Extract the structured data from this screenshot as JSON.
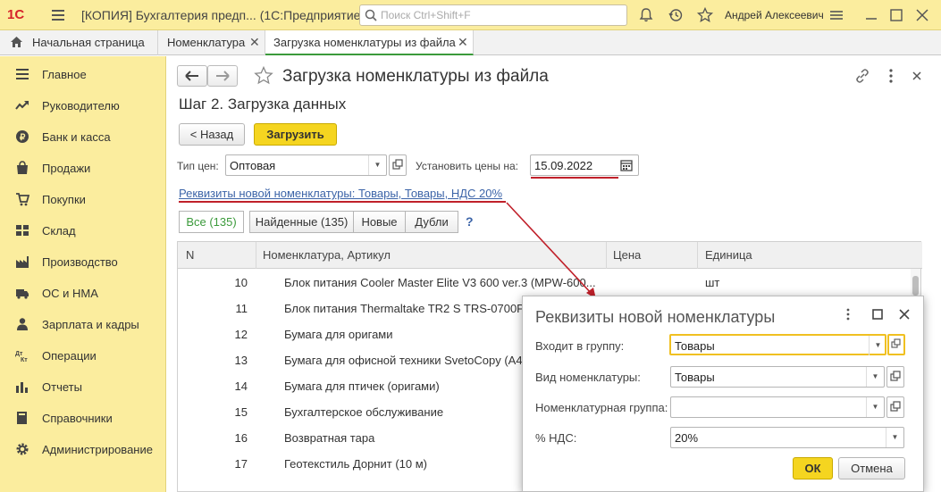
{
  "topbar": {
    "logo": "1С",
    "title": "[КОПИЯ] Бухгалтерия предп... (1С:Предприятие)",
    "search_placeholder": "Поиск Ctrl+Shift+F",
    "user": "Андрей Алексеевич"
  },
  "tabs": [
    {
      "label": "Начальная страница"
    },
    {
      "label": "Номенклатура"
    },
    {
      "label": "Загрузка номенклатуры из файла"
    }
  ],
  "sidebar": {
    "items": [
      {
        "label": "Главное",
        "icon": "menu-lines-icon"
      },
      {
        "label": "Руководителю",
        "icon": "trend-icon"
      },
      {
        "label": "Банк и касса",
        "icon": "coin-icon"
      },
      {
        "label": "Продажи",
        "icon": "bag-icon"
      },
      {
        "label": "Покупки",
        "icon": "cart-icon"
      },
      {
        "label": "Склад",
        "icon": "warehouse-icon"
      },
      {
        "label": "Производство",
        "icon": "factory-icon"
      },
      {
        "label": "ОС и НМА",
        "icon": "truck-icon"
      },
      {
        "label": "Зарплата и кадры",
        "icon": "people-icon"
      },
      {
        "label": "Операции",
        "icon": "dt-kt-icon"
      },
      {
        "label": "Отчеты",
        "icon": "bar-chart-icon"
      },
      {
        "label": "Справочники",
        "icon": "book-icon"
      },
      {
        "label": "Администрирование",
        "icon": "gear-icon"
      }
    ]
  },
  "form": {
    "title": "Загрузка номенклатуры из файла",
    "step": "Шаг 2. Загрузка данных",
    "back_label": "< Назад",
    "load_label": "Загрузить",
    "price_type_label": "Тип цен:",
    "price_type_value": "Оптовая",
    "set_prices_label": "Установить цены на:",
    "set_prices_value": "15.09.2022",
    "details_link": "Реквизиты новой номенклатуры: Товары, Товары, НДС 20%",
    "filters": [
      {
        "label": "Все (135)"
      },
      {
        "label": "Найденные (135)"
      },
      {
        "label": "Новые"
      },
      {
        "label": "Дубли"
      }
    ],
    "help": "?"
  },
  "table": {
    "columns": [
      "N",
      "Номенклатура, Артикул",
      "Цена",
      "Единица"
    ],
    "rows": [
      {
        "n": "10",
        "name": "Блок питания Cooler Master Elite V3 600 ver.3 (MPW-600...",
        "unit": "шт"
      },
      {
        "n": "11",
        "name": "Блок питания Thermaltake TR2 S TRS-0700P-",
        "unit": ""
      },
      {
        "n": "12",
        "name": "Бумага для оригами",
        "unit": ""
      },
      {
        "n": "13",
        "name": "Бумага для офисной техники SvetoCopy (А4,",
        "unit": ""
      },
      {
        "n": "14",
        "name": "Бумага для птичек (оригами)",
        "unit": ""
      },
      {
        "n": "15",
        "name": "Бухгалтерское обслуживание",
        "unit": ""
      },
      {
        "n": "16",
        "name": "Возвратная тара",
        "unit": ""
      },
      {
        "n": "17",
        "name": "Геотекстиль Дорнит (10 м)",
        "unit": ""
      }
    ]
  },
  "dialog": {
    "title": "Реквизиты новой номенклатуры",
    "group_label": "Входит в группу:",
    "group_value": "Товары",
    "kind_label": "Вид номенклатуры:",
    "kind_value": "Товары",
    "nom_group_label": "Номенклатурная группа:",
    "nom_group_value": "",
    "vat_label": "% НДС:",
    "vat_value": "20%",
    "ok_label": "ОК",
    "cancel_label": "Отмена"
  },
  "colors": {
    "accent_yellow": "#fbed9e",
    "primary_button": "#f5d520",
    "active_green": "#3b9a3b",
    "link_blue": "#3c64a8",
    "annotation_red": "#c0202a"
  }
}
